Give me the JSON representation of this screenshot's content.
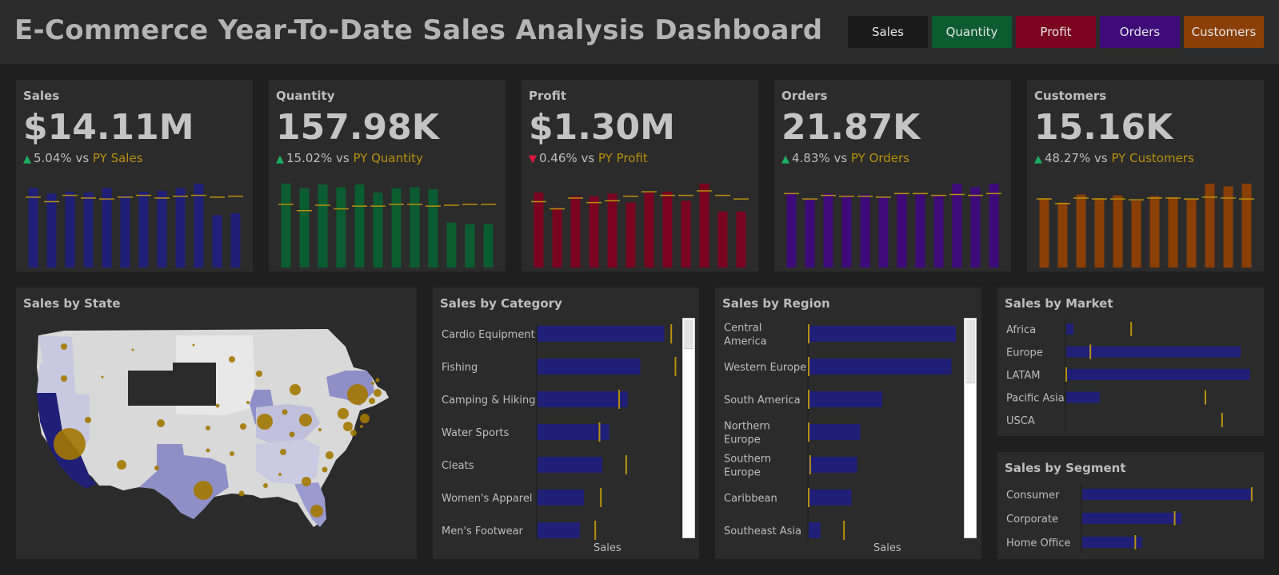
{
  "header": {
    "title": "E-Commerce Year-To-Date Sales Analysis Dashboard",
    "tabs": [
      {
        "label": "Sales",
        "color": "#1a1a1a"
      },
      {
        "label": "Quantity",
        "color": "#0b5c30"
      },
      {
        "label": "Profit",
        "color": "#7a0420"
      },
      {
        "label": "Orders",
        "color": "#3e0a7a"
      },
      {
        "label": "Customers",
        "color": "#8a3f06"
      }
    ]
  },
  "colors": {
    "sales": "#1f1f78",
    "quantity": "#0b5c30",
    "profit": "#7a0420",
    "orders": "#3e0a7a",
    "customers": "#8a3f06",
    "py_marker": "#b8900d",
    "up": "#1ab061",
    "down": "#e0143c"
  },
  "kpis": [
    {
      "id": "sales",
      "title": "Sales",
      "value": "$14.11M",
      "direction": "up",
      "arrow": "▲",
      "change": "5.04%",
      "vs": "vs",
      "py_label": "PY Sales",
      "color": "#1f1f78",
      "bars": [
        0.88,
        0.82,
        0.84,
        0.83,
        0.88,
        0.8,
        0.84,
        0.85,
        0.88,
        0.93,
        0.58,
        0.6
      ],
      "py": [
        0.78,
        0.73,
        0.8,
        0.77,
        0.76,
        0.78,
        0.8,
        0.77,
        0.79,
        0.8,
        0.78,
        0.79
      ]
    },
    {
      "id": "quantity",
      "title": "Quantity",
      "value": "157.98K",
      "direction": "up",
      "arrow": "▲",
      "change": "15.02%",
      "vs": "vs",
      "py_label": "PY Quantity",
      "color": "#0b5c30",
      "bars": [
        0.93,
        0.88,
        0.92,
        0.89,
        0.92,
        0.83,
        0.88,
        0.89,
        0.87,
        0.5,
        0.48,
        0.48
      ],
      "py": [
        0.7,
        0.63,
        0.69,
        0.65,
        0.68,
        0.68,
        0.7,
        0.7,
        0.68,
        0.69,
        0.7,
        0.7
      ]
    },
    {
      "id": "profit",
      "title": "Profit",
      "value": "$1.30M",
      "direction": "down",
      "arrow": "▼",
      "change": "0.46%",
      "vs": "vs",
      "py_label": "PY Profit",
      "color": "#7a0420",
      "bars": [
        0.83,
        0.66,
        0.79,
        0.79,
        0.82,
        0.72,
        0.83,
        0.84,
        0.74,
        0.93,
        0.62,
        0.62
      ],
      "py": [
        0.73,
        0.65,
        0.77,
        0.72,
        0.74,
        0.79,
        0.84,
        0.8,
        0.8,
        0.85,
        0.8,
        0.76
      ]
    },
    {
      "id": "orders",
      "title": "Orders",
      "value": "21.87K",
      "direction": "up",
      "arrow": "▲",
      "change": "4.83%",
      "vs": "vs",
      "py_label": "PY Orders",
      "color": "#3e0a7a",
      "bars": [
        0.83,
        0.76,
        0.82,
        0.8,
        0.81,
        0.78,
        0.82,
        0.81,
        0.8,
        0.93,
        0.89,
        0.93
      ],
      "py": [
        0.82,
        0.76,
        0.8,
        0.79,
        0.79,
        0.78,
        0.82,
        0.82,
        0.8,
        0.81,
        0.8,
        0.82
      ]
    },
    {
      "id": "customers",
      "title": "Customers",
      "value": "15.16K",
      "direction": "up",
      "arrow": "▲",
      "change": "48.27%",
      "vs": "vs",
      "py_label": "PY Customers",
      "color": "#8a3f06",
      "bars": [
        0.77,
        0.72,
        0.81,
        0.77,
        0.8,
        0.74,
        0.79,
        0.78,
        0.76,
        0.93,
        0.9,
        0.93
      ],
      "py": [
        0.76,
        0.71,
        0.77,
        0.76,
        0.76,
        0.75,
        0.77,
        0.77,
        0.76,
        0.78,
        0.77,
        0.76
      ]
    }
  ],
  "state_map": {
    "title": "Sales by State",
    "shade_color": "#8f8fc8",
    "dark_color": "#1f1f78",
    "bubble_color": "#a37800"
  },
  "category": {
    "title": "Sales by Category",
    "axis_label": "Sales",
    "items": [
      {
        "label": "Cardio Equipment",
        "value": 0.9,
        "py": 0.95
      },
      {
        "label": "Fishing",
        "value": 0.73,
        "py": 0.98
      },
      {
        "label": "Camping & Hiking",
        "value": 0.64,
        "py": 0.58
      },
      {
        "label": "Water Sports",
        "value": 0.51,
        "py": 0.44
      },
      {
        "label": "Cleats",
        "value": 0.46,
        "py": 0.63
      },
      {
        "label": "Women's Apparel",
        "value": 0.33,
        "py": 0.45
      },
      {
        "label": "Men's Footwear",
        "value": 0.3,
        "py": 0.41
      }
    ]
  },
  "region": {
    "title": "Sales by Region",
    "axis_label": "Sales",
    "items": [
      {
        "label": "Central America",
        "value": 1.0,
        "py": 0.0
      },
      {
        "label": "Western Europe",
        "value": 0.97,
        "py": 0.0
      },
      {
        "label": "South America",
        "value": 0.5,
        "py": 0.0
      },
      {
        "label": "Northern Europe",
        "value": 0.35,
        "py": 0.0
      },
      {
        "label": "Southern Europe",
        "value": 0.33,
        "py": 0.01
      },
      {
        "label": "Caribbean",
        "value": 0.29,
        "py": 0.0
      },
      {
        "label": "Southeast Asia",
        "value": 0.08,
        "py": 0.24
      }
    ]
  },
  "market": {
    "title": "Sales by Market",
    "items": [
      {
        "label": "Africa",
        "value": 0.04,
        "py": 0.35
      },
      {
        "label": "Europe",
        "value": 0.94,
        "py": 0.13
      },
      {
        "label": "LATAM",
        "value": 0.99,
        "py": 0.0
      },
      {
        "label": "Pacific Asia",
        "value": 0.18,
        "py": 0.75
      },
      {
        "label": "USCA",
        "value": 0.0,
        "py": 0.84
      }
    ]
  },
  "segment": {
    "title": "Sales by Segment",
    "items": [
      {
        "label": "Consumer",
        "value": 0.99,
        "py": 0.99
      },
      {
        "label": "Corporate",
        "value": 0.58,
        "py": 0.54
      },
      {
        "label": "Home Office",
        "value": 0.35,
        "py": 0.31
      }
    ]
  }
}
